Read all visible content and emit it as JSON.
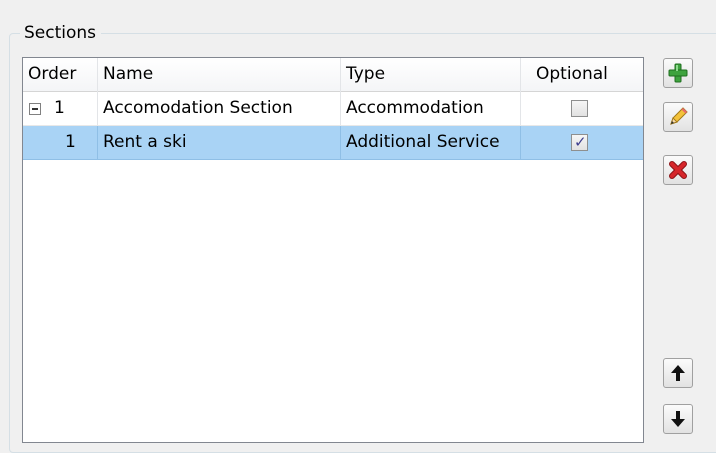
{
  "groupbox": {
    "title": "Sections"
  },
  "grid": {
    "columns": {
      "order": "Order",
      "name": "Name",
      "type": "Type",
      "optional": "Optional"
    },
    "rows": [
      {
        "order": "1",
        "name": "Accomodation Section",
        "type": "Accommodation",
        "optional": false,
        "expanded": true,
        "selected": false
      },
      {
        "order": "1",
        "name": "Rent a ski",
        "type": "Additional Service",
        "optional": true,
        "selected": true
      }
    ]
  },
  "toolbar": {
    "add_icon": "plus-icon",
    "edit_icon": "pencil-icon",
    "delete_icon": "x-icon",
    "move_up_icon": "arrow-up-icon",
    "move_down_icon": "arrow-down-icon"
  },
  "colors": {
    "selection": "#a9d3f5",
    "add_green": "#3ea33e",
    "delete_red": "#d6262b"
  }
}
